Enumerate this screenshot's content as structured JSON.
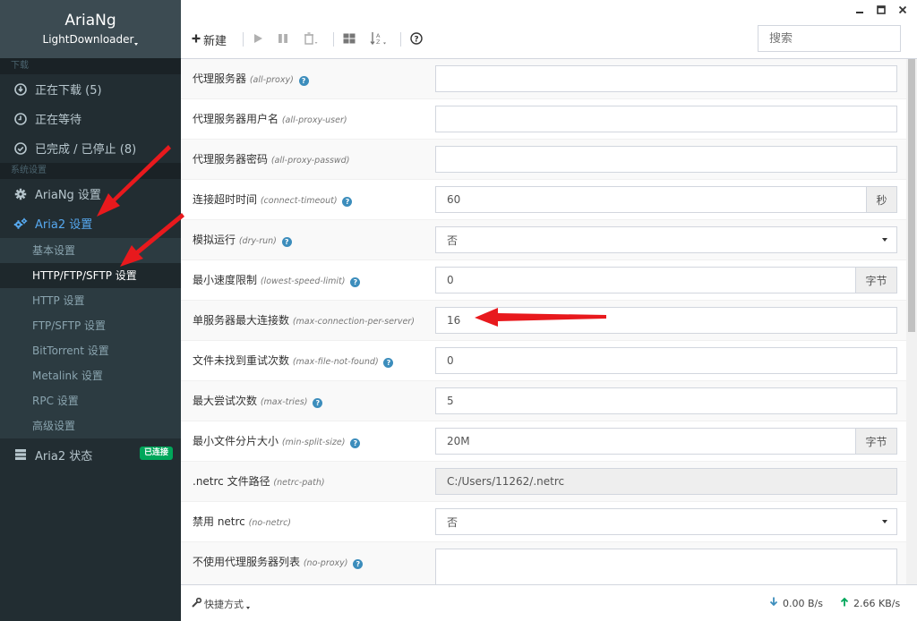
{
  "brand": {
    "title": "AriaNg",
    "subtitle": "LightDownloader"
  },
  "sidebar": {
    "download_header": "下载",
    "downloads": [
      {
        "label": "正在下载 (5)",
        "icon": "download-circle-icon"
      },
      {
        "label": "正在等待",
        "icon": "clock-icon"
      },
      {
        "label": "已完成 / 已停止 (8)",
        "icon": "check-circle-icon"
      }
    ],
    "settings_header": "系统设置",
    "ariang_settings": "AriaNg 设置",
    "aria2_settings": "Aria2 设置",
    "aria2_sub": [
      "基本设置",
      "HTTP/FTP/SFTP 设置",
      "HTTP 设置",
      "FTP/SFTP 设置",
      "BitTorrent 设置",
      "Metalink 设置",
      "RPC 设置",
      "高级设置"
    ],
    "aria2_status": "Aria2 状态",
    "status_badge": "已连接",
    "accent": "#56a8ef",
    "badge_color": "#00a65a"
  },
  "toolbar": {
    "new_label": "新建",
    "search_placeholder": "搜索"
  },
  "settings": [
    {
      "label": "代理服务器",
      "key": "(all-proxy)",
      "help": true,
      "type": "text",
      "value": ""
    },
    {
      "label": "代理服务器用户名",
      "key": "(all-proxy-user)",
      "help": false,
      "type": "text",
      "value": ""
    },
    {
      "label": "代理服务器密码",
      "key": "(all-proxy-passwd)",
      "help": false,
      "type": "text",
      "value": ""
    },
    {
      "label": "连接超时时间",
      "key": "(connect-timeout)",
      "help": true,
      "type": "addon",
      "value": "60",
      "unit": "秒"
    },
    {
      "label": "模拟运行",
      "key": "(dry-run)",
      "help": true,
      "type": "select",
      "value": "否"
    },
    {
      "label": "最小速度限制",
      "key": "(lowest-speed-limit)",
      "help": true,
      "type": "addon",
      "value": "0",
      "unit": "字节"
    },
    {
      "label": "单服务器最大连接数",
      "key": "(max-connection-per-server)",
      "help": false,
      "type": "text",
      "value": "16"
    },
    {
      "label": "文件未找到重试次数",
      "key": "(max-file-not-found)",
      "help": true,
      "type": "text",
      "value": "0"
    },
    {
      "label": "最大尝试次数",
      "key": "(max-tries)",
      "help": true,
      "type": "text",
      "value": "5"
    },
    {
      "label": "最小文件分片大小",
      "key": "(min-split-size)",
      "help": true,
      "type": "addon",
      "value": "20M",
      "unit": "字节"
    },
    {
      "label": ".netrc 文件路径",
      "key": "(netrc-path)",
      "help": false,
      "type": "disabled",
      "value": "C:/Users/11262/.netrc"
    },
    {
      "label": "禁用 netrc",
      "key": "(no-netrc)",
      "help": false,
      "type": "select",
      "value": "否"
    },
    {
      "label": "不使用代理服务器列表",
      "key": "(no-proxy)",
      "help": true,
      "type": "textarea",
      "value": ""
    }
  ],
  "footer": {
    "shortcut_label": "快捷方式",
    "download_speed": "0.00 B/s",
    "upload_speed": "2.66 KB/s"
  }
}
